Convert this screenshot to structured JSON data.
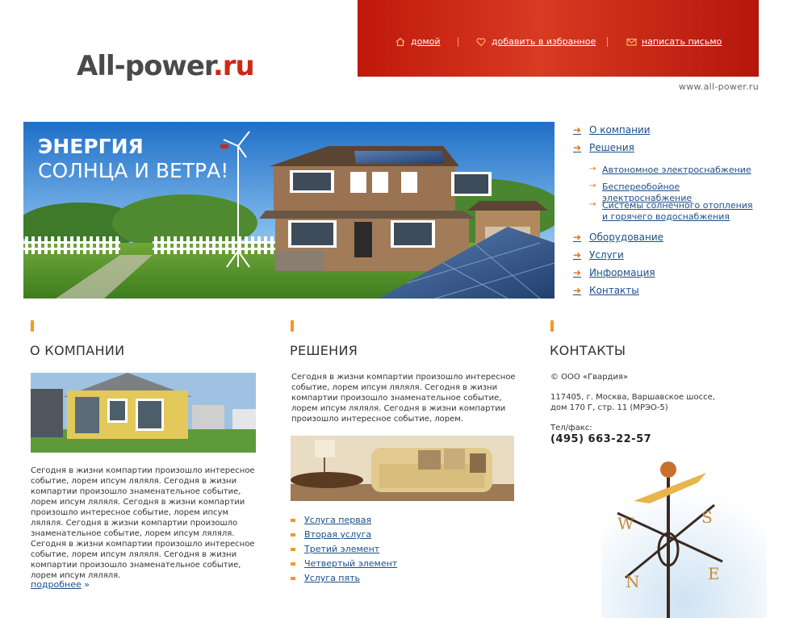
{
  "logo": {
    "name": "All-power",
    "dot": ".",
    "tld": "ru"
  },
  "topnav": [
    {
      "label": "домой",
      "icon": "home-icon"
    },
    {
      "label": "добавить в избранное",
      "icon": "heart-icon"
    },
    {
      "label": "написать письмо",
      "icon": "envelope-icon"
    }
  ],
  "site_url": "www.all-power.ru",
  "banner": {
    "title": "ЭНЕРГИЯ",
    "subtitle": "СОЛНЦА И ВЕТРА!"
  },
  "menu": {
    "items": [
      {
        "label": "О компании"
      },
      {
        "label": "Решения"
      },
      {
        "label": "Оборудование "
      },
      {
        "label": "Услуги"
      },
      {
        "label": "Информация"
      },
      {
        "label": "Контакты"
      }
    ],
    "sub_items": [
      {
        "label": "Автономное электроснабжение"
      },
      {
        "label": "Беспереобойное электроснабжение"
      },
      {
        "label": "Системы солнечного отопления и горячего водоснабжения"
      }
    ]
  },
  "about": {
    "title": "О КОМПАНИИ",
    "text": "Сегодня в жизни компартии произошло интересное событие, лорем ипсум ляляля. Сегодня в жизни компартии произошло знаменательное событие, лорем ипсум ляляля. Сегодня в жизни компартии произошло интересное событие, лорем ипсум ляляля. Сегодня в жизни компартии произошло знаменательное событие, лорем ипсум ляляля. Сегодня в жизни компартии произошло интересное событие, лорем ипсум ляляля. Сегодня в жизни компартии произошло знаменательное событие, лорем ипсум ляляля.",
    "more_label": "подробнее",
    "more_arrow": "»"
  },
  "solutions": {
    "title": "РЕШЕНИЯ",
    "text": "Сегодня в жизни компартии произошло интересное событие, лорем ипсум ляляля. Сегодня в жизни компартии произошло знаменательное событие, лорем ипсум ляляля. Сегодня в жизни компартии произошло интересное событие, лорем.",
    "services": [
      {
        "label": "Услуга первая"
      },
      {
        "label": "Вторая услуга"
      },
      {
        "label": "Третий элемент"
      },
      {
        "label": "Четвертый элемент"
      },
      {
        "label": "Услуга пять"
      }
    ]
  },
  "contacts": {
    "title": "КОНТАКТЫ",
    "company": "© ООО «Гвардия»",
    "address_1": "117405, г. Москва, Варшавское шоссе,",
    "address_2": "дом 170 Г, стр. 11 (МРЭО-5)",
    "phone_label": "Тел/факс:",
    "phone": "(495) 663-22-57"
  },
  "colors": {
    "accent": "#c41a0e",
    "marker": "#f39a1e",
    "link": "#1b4f8a"
  }
}
